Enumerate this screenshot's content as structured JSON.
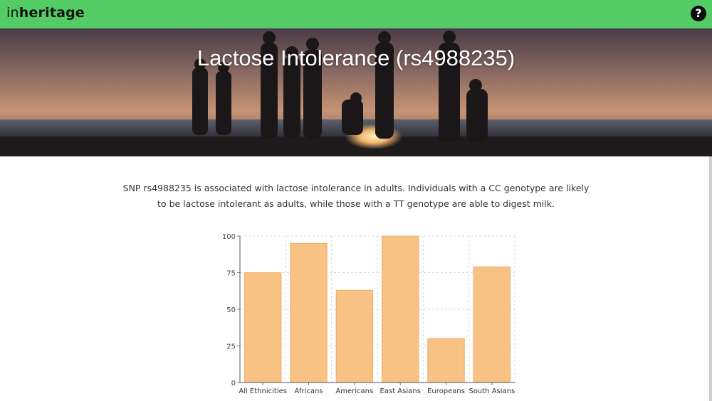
{
  "app": {
    "brand_light": "in",
    "brand_bold": "heritage"
  },
  "header": {
    "help_label": "?"
  },
  "hero": {
    "title": "Lactose Intolerance (rs4988235)"
  },
  "description": "SNP rs4988235 is associated with lactose intolerance in adults. Individuals with a CC genotype are likely to be lactose intolerant as adults, while those with a TT genotype are able to digest milk.",
  "colors": {
    "topbar": "#53cc65",
    "bar_fill": "#f7c284",
    "bar_stroke": "#eeae68"
  },
  "chart_data": {
    "type": "bar",
    "categories": [
      "All Ethnicities",
      "Africans",
      "Americans",
      "East Asians",
      "Europeans",
      "South Asians"
    ],
    "values": [
      75,
      95,
      63,
      100,
      30,
      79
    ],
    "yticks": [
      0,
      25,
      50,
      75,
      100
    ],
    "ylim": [
      0,
      100
    ],
    "grid": true
  }
}
